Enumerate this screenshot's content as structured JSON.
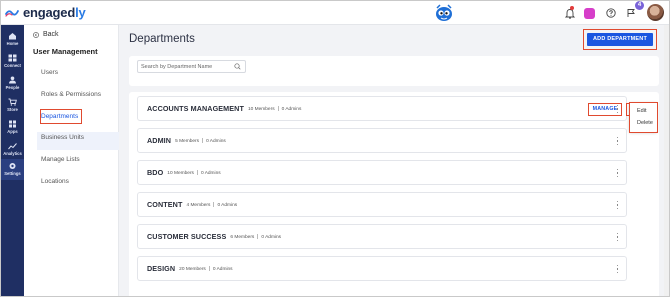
{
  "app": {
    "logo_text_main": "engaged",
    "logo_text_accent": "ly",
    "notification_count": "4"
  },
  "rail": {
    "items": [
      {
        "label": "Home",
        "icon": "home-icon"
      },
      {
        "label": "Connect",
        "icon": "connect-icon"
      },
      {
        "label": "People",
        "icon": "people-icon"
      },
      {
        "label": "Store",
        "icon": "cart-icon"
      },
      {
        "label": "Apps",
        "icon": "apps-icon"
      },
      {
        "label": "Analytics",
        "icon": "analytics-icon"
      },
      {
        "label": "Settings",
        "icon": "gear-icon"
      }
    ]
  },
  "sidebar": {
    "back_label": "Back",
    "section_title": "User Management",
    "items": [
      {
        "label": "Users"
      },
      {
        "label": "Roles & Permissions"
      },
      {
        "label": "Departments"
      },
      {
        "label": "Business Units"
      },
      {
        "label": "Manage Lists"
      },
      {
        "label": "Locations"
      }
    ]
  },
  "main": {
    "title": "Departments",
    "add_button": "ADD DEPARTMENT",
    "search_placeholder": "Search by Department Name",
    "manage_label": "MANAGE",
    "departments": [
      {
        "name": "ACCOUNTS MANAGEMENT",
        "members": "10 Members",
        "admins": "0 Admins"
      },
      {
        "name": "ADMIN",
        "members": "5 Members",
        "admins": "0 Admins"
      },
      {
        "name": "BDO",
        "members": "10 Members",
        "admins": "0 Admins"
      },
      {
        "name": "CONTENT",
        "members": "4 Members",
        "admins": "0 Admins"
      },
      {
        "name": "CUSTOMER SUCCESS",
        "members": "6 Members",
        "admins": "0 Admins"
      },
      {
        "name": "DESIGN",
        "members": "20 Members",
        "admins": "0 Admins"
      }
    ],
    "row_menu": {
      "items": [
        "Edit",
        "Delete"
      ]
    }
  },
  "colors": {
    "rail": "#1f2f63",
    "accent": "#1a56e0",
    "highlight": "#e04a2f"
  }
}
